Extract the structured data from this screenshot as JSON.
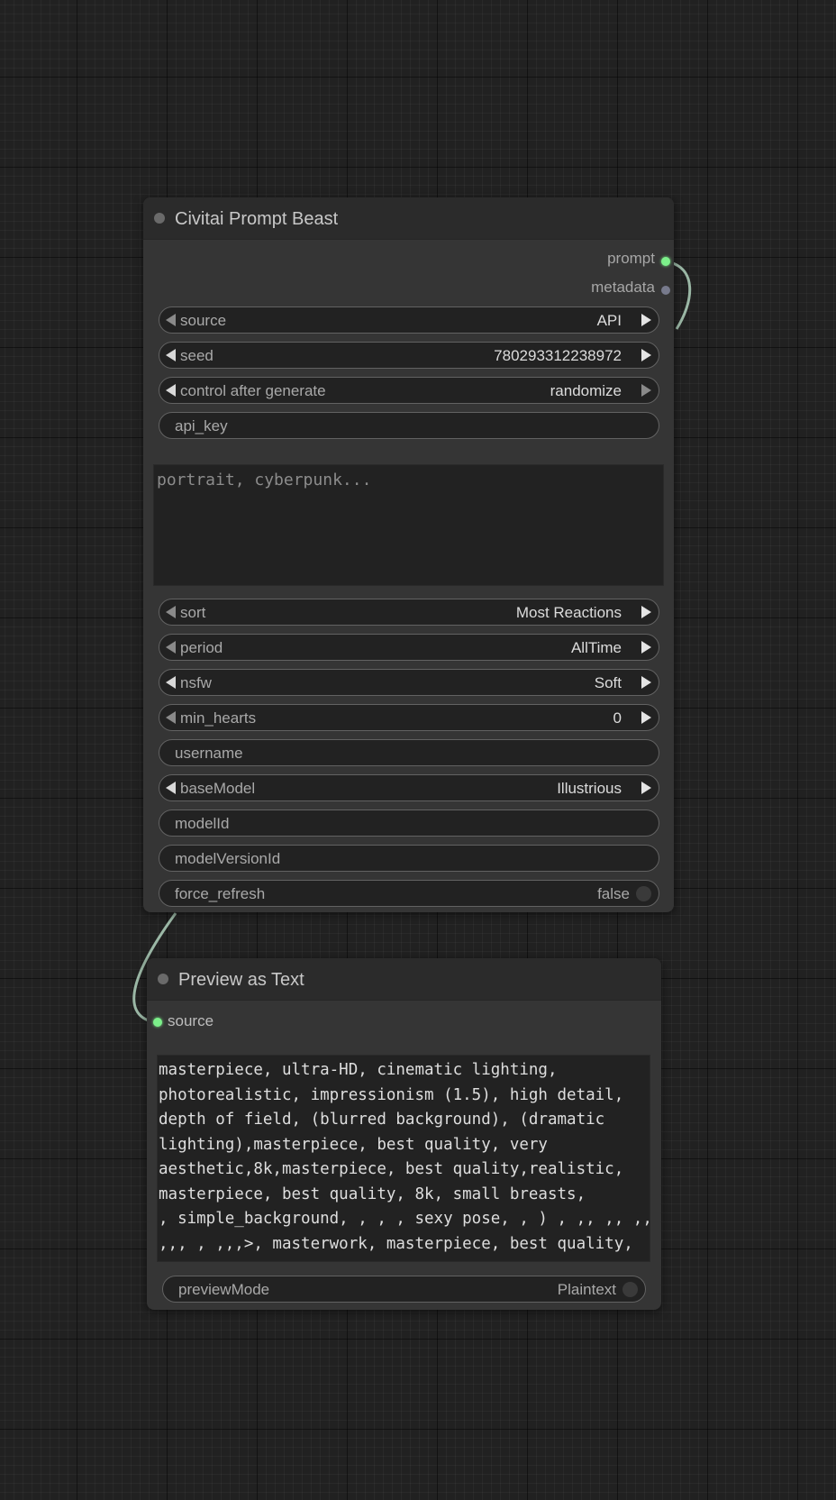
{
  "nodes": {
    "prompt_beast": {
      "title": "Civitai Prompt Beast",
      "outputs": {
        "prompt": "prompt",
        "metadata": "metadata"
      },
      "widgets": {
        "source": {
          "label": "source",
          "value": "API"
        },
        "seed": {
          "label": "seed",
          "value": "780293312238972"
        },
        "control_after_generate": {
          "label": "control after generate",
          "value": "randomize"
        },
        "api_key": {
          "label": "api_key"
        },
        "prompt_text": {
          "placeholder": "portrait, cyberpunk..."
        },
        "sort": {
          "label": "sort",
          "value": "Most Reactions"
        },
        "period": {
          "label": "period",
          "value": "AllTime"
        },
        "nsfw": {
          "label": "nsfw",
          "value": "Soft"
        },
        "min_hearts": {
          "label": "min_hearts",
          "value": "0"
        },
        "username": {
          "label": "username"
        },
        "baseModel": {
          "label": "baseModel",
          "value": "Illustrious"
        },
        "modelId": {
          "label": "modelId"
        },
        "modelVersionId": {
          "label": "modelVersionId"
        },
        "force_refresh": {
          "label": "force_refresh",
          "value": "false"
        }
      }
    },
    "preview_text": {
      "title": "Preview as Text",
      "input": {
        "label": "source"
      },
      "content": "masterpiece, ultra-HD, cinematic lighting,\nphotorealistic, impressionism (1.5), high detail,\ndepth of field, (blurred background), (dramatic\nlighting),masterpiece, best quality, very\naesthetic,8k,masterpiece, best quality,realistic,\nmasterpiece, best quality, 8k, small breasts,\n, simple_background, , , , sexy pose, , ) , ,, ,, ,,\n,,, , ,,,>, masterwork, masterpiece, best quality,",
      "previewMode": {
        "label": "previewMode",
        "value": "Plaintext"
      }
    }
  },
  "colors": {
    "canvas": "#212121",
    "node_body": "#353535",
    "node_header": "#2b2b2b",
    "widget_bg": "#222222",
    "wire": "#9bb8a6",
    "slot_connected": "#7cf08a",
    "slot_unconnected": "#777a8c"
  }
}
